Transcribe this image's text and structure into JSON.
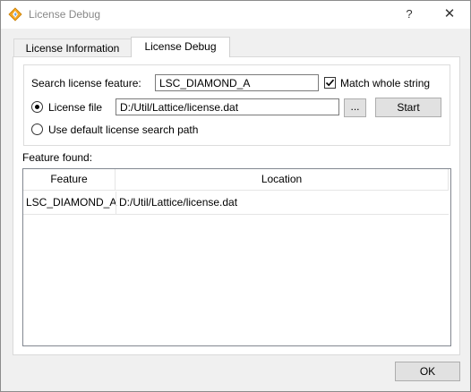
{
  "window": {
    "title": "License Debug",
    "help_glyph": "?",
    "close_glyph": "✕"
  },
  "tabs": [
    {
      "label": "License Information",
      "active": false
    },
    {
      "label": "License Debug",
      "active": true
    }
  ],
  "search": {
    "label": "Search license feature:",
    "value": "LSC_DIAMOND_A",
    "match_whole_label": "Match whole string",
    "match_whole_checked": true
  },
  "license_file": {
    "label": "License file",
    "selected": true,
    "value": "D:/Util/Lattice/license.dat",
    "browse_label": "...",
    "start_label": "Start"
  },
  "default_path": {
    "label": "Use default license search path",
    "selected": false
  },
  "results": {
    "label": "Feature found:",
    "columns": [
      "Feature",
      "Location"
    ],
    "rows": [
      {
        "feature": "LSC_DIAMOND_A",
        "location": "D:/Util/Lattice/license.dat"
      }
    ]
  },
  "footer": {
    "ok_label": "OK"
  },
  "colors": {
    "icon_diamond": "#f5a623",
    "icon_bolt": "#4a90e2"
  }
}
